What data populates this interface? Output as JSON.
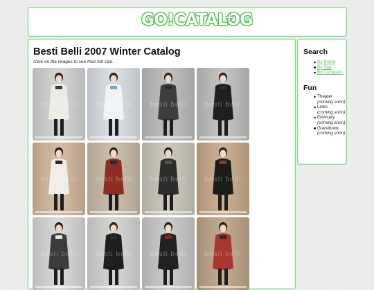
{
  "header": {
    "logo_text": "GO!CATALOG",
    "logo_plus": "+"
  },
  "main": {
    "title": "Besti Belli 2007 Winter Catalog",
    "subtitle": "Click on the images to see their full size.",
    "watermark": "besti belli",
    "photos": [
      {
        "name": "photo-1",
        "bg": "#cfd2d0",
        "coat": "#ecebe6",
        "acc": "#3b3b3b"
      },
      {
        "name": "photo-2",
        "bg": "#d8dde2",
        "coat": "#f2f3f4",
        "acc": "#7fa3c8"
      },
      {
        "name": "photo-3",
        "bg": "#b9bab8",
        "coat": "#3d3d3d",
        "acc": "#2a2a2a"
      },
      {
        "name": "photo-4",
        "bg": "#bdbdbb",
        "coat": "#1f1f1f",
        "acc": "#2b2b2b"
      },
      {
        "name": "photo-5",
        "bg": "#d1b59a",
        "coat": "#f1eeea",
        "acc": "#2a2a2a"
      },
      {
        "name": "photo-6",
        "bg": "#c6b9a4",
        "coat": "#8f2d24",
        "acc": "#2b2b2b"
      },
      {
        "name": "photo-7",
        "bg": "#c9c4b8",
        "coat": "#2d2d2d",
        "acc": "#555555"
      },
      {
        "name": "photo-8",
        "bg": "#c7a787",
        "coat": "#1c1c1c",
        "acc": "#6b4b34"
      },
      {
        "name": "photo-9",
        "bg": "#d5d6d4",
        "coat": "#3b3b3b",
        "acc": "#e8e8e8"
      },
      {
        "name": "photo-10",
        "bg": "#d2d3d1",
        "coat": "#1e1e1e",
        "acc": "#2b2b2b"
      },
      {
        "name": "photo-11",
        "bg": "#c6c7c5",
        "coat": "#222222",
        "acc": "#8a2424"
      },
      {
        "name": "photo-12",
        "bg": "#bda286",
        "coat": "#a8382f",
        "acc": "#2b2b2b"
      }
    ]
  },
  "sidebar": {
    "search_heading": "Search",
    "search_links": [
      {
        "label": "By Brand"
      },
      {
        "label": "By Stat"
      },
      {
        "label": "By Company"
      }
    ],
    "fun_heading": "Fun",
    "fun_items": [
      {
        "label": "Theater",
        "note": "(coming soon)"
      },
      {
        "label": "Links",
        "note": "(coming soon)"
      },
      {
        "label": "Glossary",
        "note": "(coming soon)"
      },
      {
        "label": "Guestbook",
        "note": "(coming soon)"
      }
    ]
  },
  "colors": {
    "accent": "#5fbf5f",
    "border": "#8fd68f"
  }
}
